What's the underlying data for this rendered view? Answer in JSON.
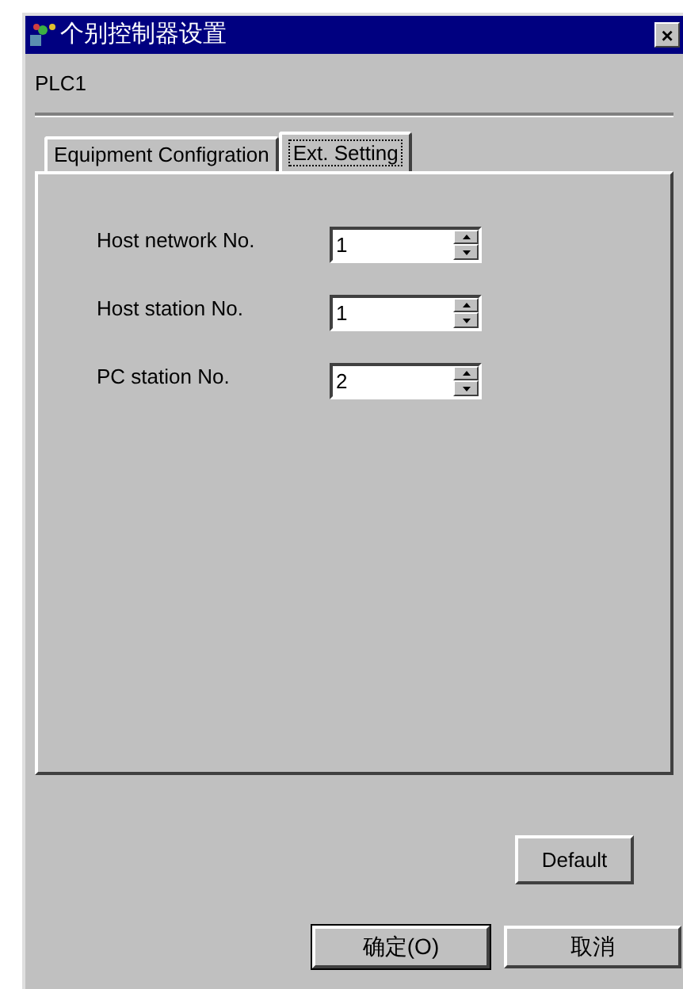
{
  "window": {
    "title": "个别控制器设置",
    "close": "×"
  },
  "device": "PLC1",
  "tabs": [
    {
      "label": "Equipment Configration",
      "selected": false
    },
    {
      "label": "Ext. Setting",
      "selected": true
    }
  ],
  "fields": [
    {
      "label": "Host network No.",
      "value": "1"
    },
    {
      "label": "Host station No.",
      "value": "1"
    },
    {
      "label": "PC station No.",
      "value": "2"
    }
  ],
  "default_button": "Default",
  "buttons": [
    {
      "label": "确定(O)",
      "selected": true
    },
    {
      "label": "取消",
      "selected": false
    }
  ]
}
